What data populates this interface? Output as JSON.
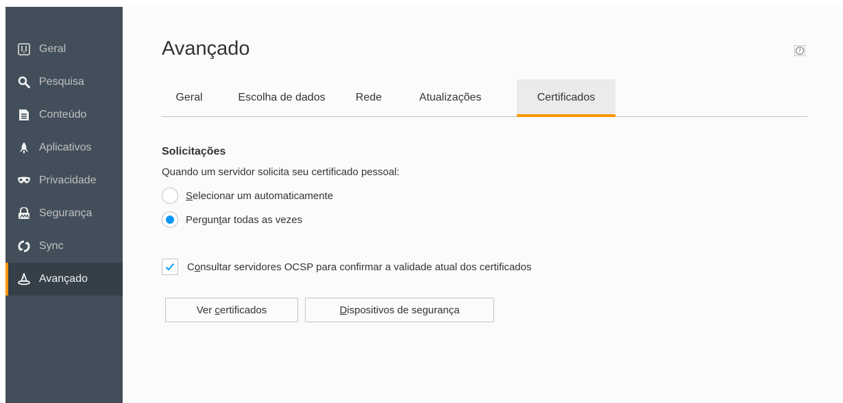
{
  "sidebar": {
    "items": [
      {
        "label": "Geral",
        "icon": "general-icon",
        "active": false
      },
      {
        "label": "Pesquisa",
        "icon": "search-icon",
        "active": false
      },
      {
        "label": "Conteúdo",
        "icon": "content-icon",
        "active": false
      },
      {
        "label": "Aplicativos",
        "icon": "applications-rocket-icon",
        "active": false
      },
      {
        "label": "Privacidade",
        "icon": "privacy-mask-icon",
        "active": false
      },
      {
        "label": "Segurança",
        "icon": "security-lock-icon",
        "active": false
      },
      {
        "label": "Sync",
        "icon": "sync-icon",
        "active": false
      },
      {
        "label": "Avançado",
        "icon": "advanced-wizard-hat-icon",
        "active": true
      }
    ]
  },
  "header": {
    "title": "Avançado",
    "help_icon": "help-question-icon"
  },
  "tabs": [
    {
      "label": "Geral",
      "active": false
    },
    {
      "label": "Escolha de dados",
      "active": false
    },
    {
      "label": "Rede",
      "active": false
    },
    {
      "label": "Atualizações",
      "active": false
    },
    {
      "label": "Certificados",
      "active": true
    }
  ],
  "requests": {
    "title": "Solicitações",
    "description": "Quando um servidor solicita seu certificado pessoal:",
    "option_auto": {
      "before": "",
      "accesskey": "S",
      "after": "elecionar um automaticamente",
      "checked": false
    },
    "option_ask": {
      "before": "Pergun",
      "accesskey": "t",
      "after": "ar todas as vezes",
      "checked": true
    }
  },
  "ocsp": {
    "before": "C",
    "accesskey": "o",
    "after": "nsultar servidores OCSP para confirmar a validade atual dos certificados",
    "checked": true
  },
  "buttons": {
    "view_certs": {
      "before": "Ver ",
      "accesskey": "c",
      "after": "ertificados"
    },
    "security_devices": {
      "before": "",
      "accesskey": "D",
      "after": "ispositivos de segurança"
    }
  },
  "colors": {
    "sidebar_bg": "#424f5a",
    "sidebar_active_bg": "#343f48",
    "accent_orange": "#ff9500",
    "accent_blue": "#0996f8"
  }
}
